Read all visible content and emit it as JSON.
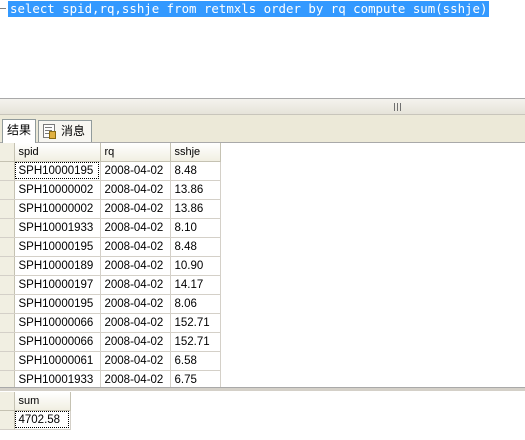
{
  "editor": {
    "sql": "select spid,rq,sshje from retmxls order by rq compute sum(sshje)"
  },
  "tabs": [
    {
      "label": "结果",
      "active": true
    },
    {
      "label": "消息",
      "active": false
    }
  ],
  "results": {
    "columns": [
      "spid",
      "rq",
      "sshje"
    ],
    "rows": [
      [
        "SPH10000195",
        "2008-04-02",
        "8.48"
      ],
      [
        "SPH10000002",
        "2008-04-02",
        "13.86"
      ],
      [
        "SPH10000002",
        "2008-04-02",
        "13.86"
      ],
      [
        "SPH10001933",
        "2008-04-02",
        "8.10"
      ],
      [
        "SPH10000195",
        "2008-04-02",
        "8.48"
      ],
      [
        "SPH10000189",
        "2008-04-02",
        "10.90"
      ],
      [
        "SPH10000197",
        "2008-04-02",
        "14.17"
      ],
      [
        "SPH10000195",
        "2008-04-02",
        "8.06"
      ],
      [
        "SPH10000066",
        "2008-04-02",
        "152.71"
      ],
      [
        "SPH10000066",
        "2008-04-02",
        "152.71"
      ],
      [
        "SPH10000061",
        "2008-04-02",
        "6.58"
      ],
      [
        "SPH10001933",
        "2008-04-02",
        "6.75"
      ]
    ]
  },
  "compute": {
    "column": "sum",
    "value": "4702.58"
  },
  "colors": {
    "selection": "#3399ff",
    "chrome": "#ece9d8",
    "gridline": "#d4d0c8"
  }
}
